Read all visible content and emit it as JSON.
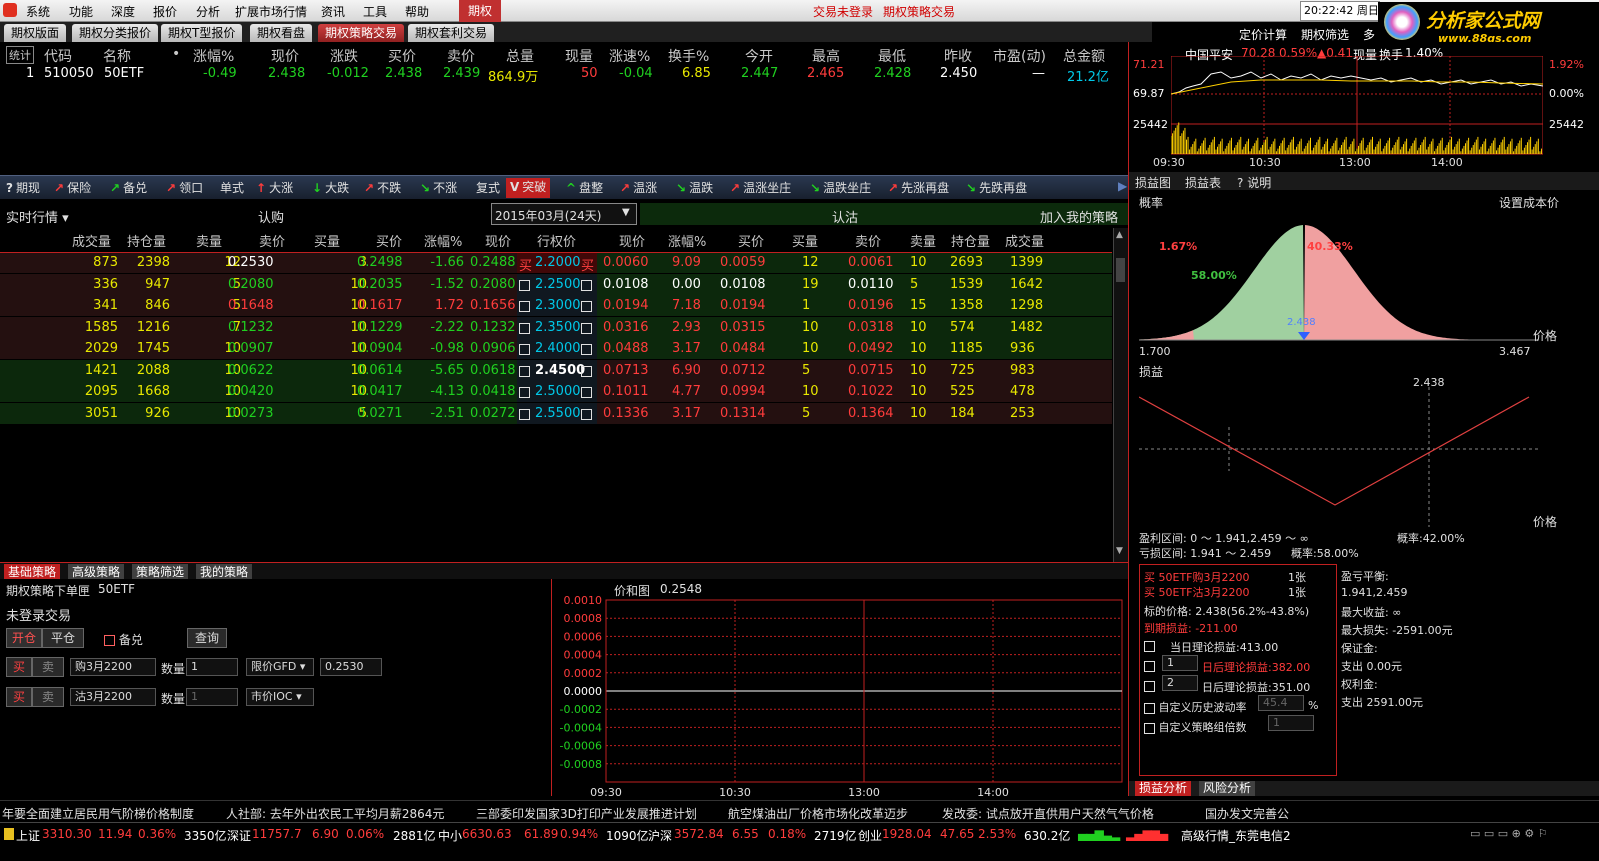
{
  "menu": {
    "items": [
      "系统",
      "功能",
      "深度",
      "报价",
      "分析",
      "扩展市场行情",
      "资讯",
      "工具",
      "帮助"
    ],
    "active": "期权",
    "status1": "交易未登录",
    "status2": "期权策略交易",
    "time": "20:22:42 周日",
    "xing": "行"
  },
  "logo": {
    "text": "分析家公式网",
    "url": "www.88gs.com"
  },
  "tabs": [
    "期权版面",
    "期权分类报价",
    "期权T型报价",
    "期权看盘",
    "期权策略交易",
    "期权套利交易"
  ],
  "quote": {
    "headers": [
      "统计",
      "代码",
      "名称",
      "•",
      "涨幅%",
      "现价",
      "涨跌",
      "买价",
      "卖价",
      "总量",
      "现量",
      "涨速%",
      "换手%",
      "今开",
      "最高",
      "最低",
      "昨收",
      "市盈(动)",
      "总金额"
    ],
    "row": [
      "1",
      "510050",
      "50ETF",
      "",
      "-0.49",
      "2.438",
      "-0.012",
      "2.438",
      "2.439",
      "864.9万",
      "50",
      "-0.04",
      "6.85",
      "2.447",
      "2.465",
      "2.428",
      "2.450",
      "—",
      "21.2亿"
    ]
  },
  "rchart": {
    "menu": [
      "定价计算",
      "期权筛选",
      "多"
    ],
    "title": "中国平安",
    "price": "70.28",
    "pct": "0.59%",
    "chg": "▲0.41",
    "extra": "现量",
    "hand": "换手",
    "handval": "1.40%",
    "yhi": "71.21",
    "ymid": "69.87",
    "vol": "25442",
    "rpct1": "1.92%",
    "rpct2": "0.00%",
    "rvol": "25442",
    "times": [
      "09:30",
      "10:30",
      "13:00",
      "14:00"
    ]
  },
  "strategy_bar": [
    "期现",
    "保险",
    "备兑",
    "领口",
    "单式",
    "大涨",
    "大跌",
    "不跌",
    "不涨",
    "复式",
    "突破",
    "盘整",
    "温涨",
    "温跌",
    "温涨坐庄",
    "温跌坐庄",
    "先涨再盘",
    "先跌再盘"
  ],
  "opt_header": {
    "realtime": "实时行情",
    "call": "认购",
    "month": "2015年03月(24天)",
    "put": "认沽",
    "add": "加入我的策略"
  },
  "opt_cols": [
    "成交量",
    "持仓量",
    "卖量",
    "卖价",
    "买量",
    "买价",
    "涨幅%",
    "现价",
    "行权价",
    "现价",
    "涨幅%",
    "买价",
    "买量",
    "卖价",
    "卖量",
    "持仓量",
    "成交量"
  ],
  "opt_rows": [
    [
      "873",
      "2398",
      "12",
      "0.2530",
      "3",
      "0.2498",
      "-1.66",
      "0.2488",
      "2.2000",
      "0.0060",
      "9.09",
      "0.0059",
      "12",
      "0.0061",
      "10",
      "2693",
      "1399"
    ],
    [
      "336",
      "947",
      "5",
      "0.2080",
      "10",
      "0.2035",
      "-1.52",
      "0.2080",
      "2.2500",
      "0.0108",
      "0.00",
      "0.0108",
      "19",
      "0.0110",
      "5",
      "1539",
      "1642"
    ],
    [
      "341",
      "846",
      "5",
      "0.1648",
      "10",
      "0.1617",
      "1.72",
      "0.1656",
      "2.3000",
      "0.0194",
      "7.18",
      "0.0194",
      "1",
      "0.0196",
      "15",
      "1358",
      "1298"
    ],
    [
      "1585",
      "1216",
      "7",
      "0.1232",
      "10",
      "0.1229",
      "-2.22",
      "0.1232",
      "2.3500",
      "0.0316",
      "2.93",
      "0.0315",
      "10",
      "0.0318",
      "10",
      "574",
      "1482"
    ],
    [
      "2029",
      "1745",
      "10",
      "0.0907",
      "10",
      "0.0904",
      "-0.98",
      "0.0906",
      "2.4000",
      "0.0488",
      "3.17",
      "0.0484",
      "10",
      "0.0492",
      "10",
      "1185",
      "936"
    ],
    [
      "1421",
      "2088",
      "10",
      "0.0622",
      "10",
      "0.0614",
      "-5.65",
      "0.0618",
      "2.4500",
      "0.0713",
      "6.90",
      "0.0712",
      "5",
      "0.0715",
      "10",
      "725",
      "983"
    ],
    [
      "2095",
      "1668",
      "10",
      "0.0420",
      "10",
      "0.0417",
      "-4.13",
      "0.0418",
      "2.5000",
      "0.1011",
      "4.77",
      "0.0994",
      "10",
      "0.1022",
      "10",
      "525",
      "478"
    ],
    [
      "3051",
      "926",
      "10",
      "0.0273",
      "5",
      "0.0271",
      "-2.51",
      "0.0272",
      "2.5500",
      "0.1336",
      "3.17",
      "0.1314",
      "5",
      "0.1364",
      "10",
      "184",
      "253"
    ]
  ],
  "buy_label": "买",
  "btabs": [
    "基础策略",
    "高级策略",
    "策略筛选",
    "我的策略"
  ],
  "order": {
    "title": "期权策略下单匣",
    "code": "50ETF",
    "status": "未登录交易",
    "open": "开仓",
    "close": "平仓",
    "cover": "备兑",
    "query": "查询",
    "buy": "买",
    "sell": "卖",
    "leg1": "购3月2200",
    "leg2": "沽3月2200",
    "qty_label": "数量",
    "qty1": "1",
    "qty2": "1",
    "type1": "限价GFD",
    "type2": "市价IOC",
    "price1": "0.2530"
  },
  "valchart": {
    "title": "价和图",
    "val": "0.2548",
    "ylabels": [
      "0.0010",
      "0.0008",
      "0.0006",
      "0.0004",
      "0.0002",
      "0.0000",
      "-0.0002",
      "-0.0004",
      "-0.0006",
      "-0.0008"
    ],
    "times": [
      "09:30",
      "10:30",
      "13:00",
      "14:00"
    ]
  },
  "rpanel": {
    "tabs": [
      "损益图",
      "损益表",
      "说明"
    ],
    "prob": "概率",
    "setcost": "设置成本价",
    "p1": "1.67%",
    "p2": "58.00%",
    "p3": "40.33%",
    "spot": "2.438",
    "price_label": "价格",
    "xmin": "1.700",
    "xmax": "3.467",
    "pnl": "损益",
    "spot2": "2.438",
    "profit_range": "盈利区间: 0 ～ 1.941,2.459 ～ ∞",
    "profit_prob": "概率:42.00%",
    "loss_range": "亏损区间: 1.941 ～ 2.459",
    "loss_prob": "概率:58.00%"
  },
  "summary": {
    "leg1": "买  50ETF购3月2200",
    "leg1q": "1张",
    "leg2": "买  50ETF沽3月2200",
    "leg2q": "1张",
    "target": "标的价格: 2.438(56.2%-43.8%)",
    "expiry": "到期损益: -211.00",
    "today": "当日理论损益:413.00",
    "d1": "日后理论损益:382.00",
    "d2": "日后理论损益:351.00",
    "hv": "自定义历史波动率",
    "hvval": "45.4",
    "mult": "自定义策略组倍数",
    "multval": "1",
    "n1": "1",
    "n2": "2",
    "pct": "%",
    "bal": "盈亏平衡:",
    "balv": "1.941,2.459",
    "maxp": "最大收益: ∞",
    "maxl": "最大损失: -2591.00元",
    "margin": "保证金:",
    "out1": "支出 0.00元",
    "prem": "权利金:",
    "out2": "支出 2591.00元"
  },
  "rbtabs": [
    "损益分析",
    "风险分析"
  ],
  "ticker": [
    "年要全面建立居民用气阶梯价格制度",
    "人社部: 去年外出农民工平均月薪2864元",
    "三部委印发国家3D打印产业发展推进计划",
    "航空煤油出厂价格市场化改革迈步",
    "发改委: 试点放开直供用户天然气气价格",
    "国办发文完善公"
  ],
  "status": {
    "sh": "上证",
    "shv": "3310.30",
    "shc": "11.94",
    "shp": "0.36%",
    "sha": "3350亿",
    "sz": "深证",
    "szv": "11757.7",
    "szc": "6.90",
    "szp": "0.06%",
    "sza": "2881亿",
    "zx": "中小",
    "zxv": "6630.63",
    "zxc": "61.89",
    "zxp": "0.94%",
    "zxa": "1090亿",
    "hs": "沪深",
    "hsv": "3572.84",
    "hsc": "6.55",
    "hsp": "0.18%",
    "hsa": "2719亿",
    "cy": "创业",
    "cyv": "1928.04",
    "cyc": "47.65",
    "cyp": "2.53%",
    "cya": "630.2亿",
    "server": "高级行情_东莞电信2"
  },
  "colors": {
    "up": "#ff3c3c",
    "down": "#20d020",
    "accent": "#c02020"
  }
}
